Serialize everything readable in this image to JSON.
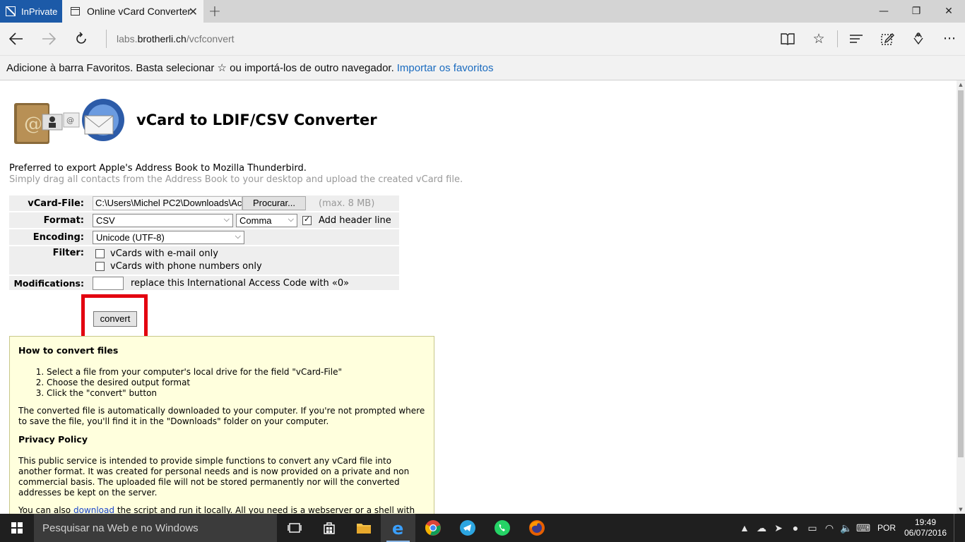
{
  "browser": {
    "private_tab_label": "InPrivate",
    "active_tab_title": "Online vCard Converter",
    "address_domain_prefix": "labs.",
    "address_domain": "brotherli.ch",
    "address_path": "/vcfconvert",
    "favbar_text": "Adicione à barra Favoritos. Basta selecionar ☆ ou importá-los de outro navegador.",
    "favbar_link": "Importar os favoritos"
  },
  "page": {
    "title": "vCard to LDIF/CSV Converter",
    "intro_line1": "Preferred to export Apple's Address Book to Mozilla Thunderbird.",
    "intro_line2": "Simply drag all contacts from the Address Book to your desktop and upload the created vCard file.",
    "form": {
      "vcard_label": "vCard-File:",
      "file_value": "C:\\Users\\Michel PC2\\Downloads\\Ac",
      "browse_label": "Procurar...",
      "max_size": "(max. 8 MB)",
      "format_label": "Format:",
      "format_value": "CSV",
      "delimiter_value": "Comma",
      "header_line_label": "Add header line",
      "header_line_checked": true,
      "encoding_label": "Encoding:",
      "encoding_value": "Unicode (UTF-8)",
      "filter_label": "Filter:",
      "filter_email_label": "vCards with e-mail only",
      "filter_phone_label": "vCards with phone numbers only",
      "modifications_label": "Modifications:",
      "modifications_value": "",
      "modifications_text": "replace this International Access Code with «0»",
      "convert_label": "convert"
    },
    "howto": {
      "heading": "How to convert files",
      "steps": [
        "Select a file from your computer's local drive for the field \"vCard-File\"",
        "Choose the desired output format",
        "Click the \"convert\" button"
      ],
      "para1": "The converted file is automatically downloaded to your computer. If you're not prompted where to save the file, you'll find it in the \"Downloads\" folder on your computer.",
      "privacy_heading": "Privacy Policy",
      "para2": "This public service is intended to provide simple functions to convert any vCard file into another format. It was created for personal needs and is now provided on a private and non commercial basis. The uploaded file will not be stored permanently nor will the converted addresses be kept on the server.",
      "para3_prefix": "You can also ",
      "para3_link": "download",
      "para3_suffix": " the script and run it locally. All you need is a webserver or a shell with"
    }
  },
  "taskbar": {
    "search_placeholder": "Pesquisar na Web e no Windows",
    "language": "POR",
    "time": "19:49",
    "date": "06/07/2016"
  },
  "colors": {
    "private_tab": "#1c5aa8",
    "highlight_border": "#e3000f",
    "howto_bg": "#ffffdd",
    "link": "#1a6bbf"
  }
}
